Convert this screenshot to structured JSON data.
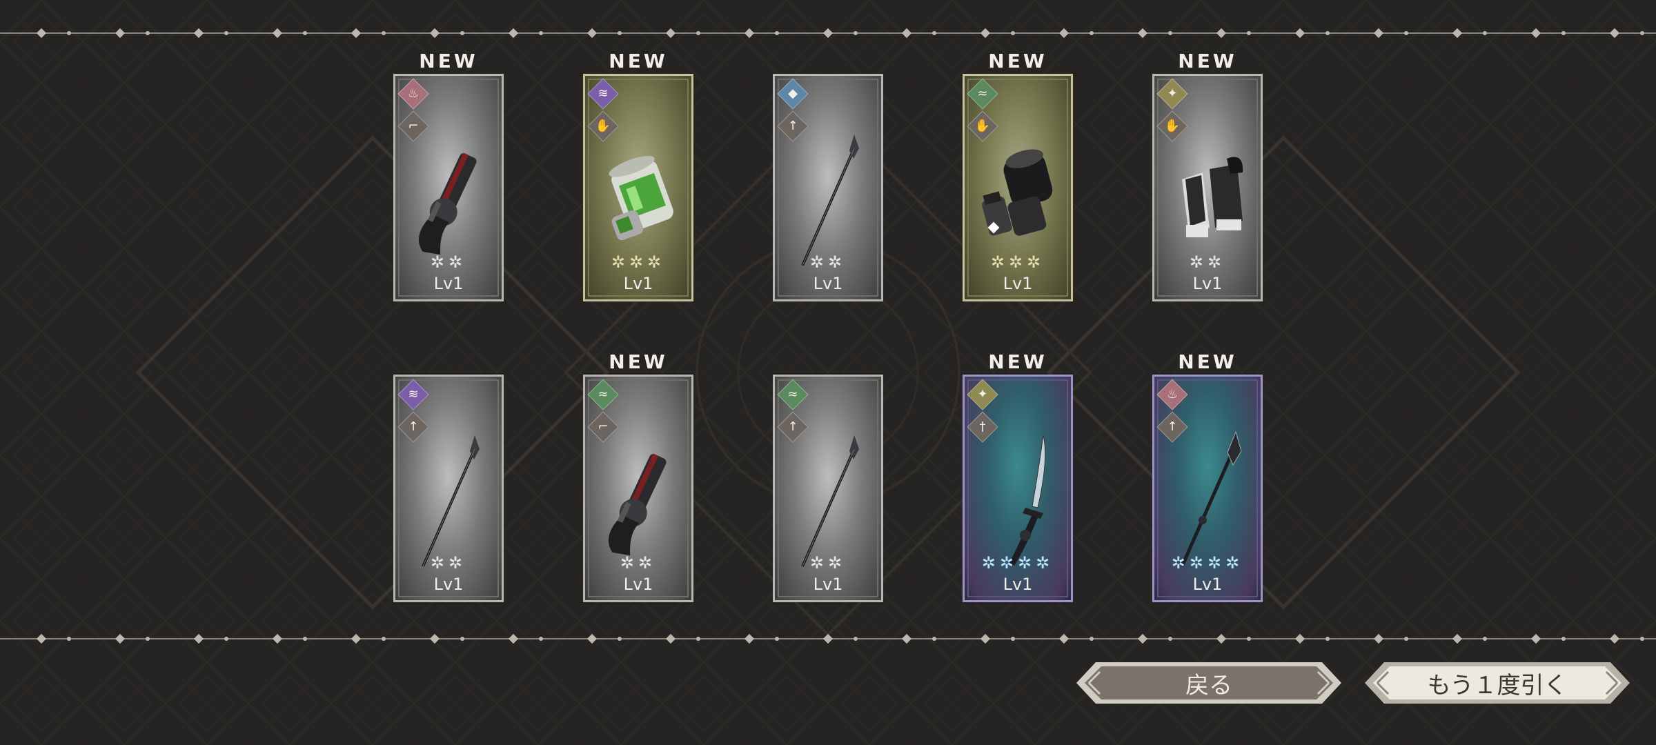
{
  "new_badge": "NEW",
  "items": [
    {
      "new": true,
      "rarity": 2,
      "frame": "gray",
      "attr_color": "#a8707a",
      "attr_icon": "flame-icon",
      "type_icon": "pistol-icon",
      "art": "revolver",
      "stars": "✲✲",
      "level": "Lv1"
    },
    {
      "new": true,
      "rarity": 3,
      "frame": "olive",
      "attr_color": "#7a5fa8",
      "attr_icon": "wave-icon",
      "type_icon": "gauntlet-icon",
      "art": "canister",
      "stars": "✲✲✲",
      "level": "Lv1"
    },
    {
      "new": false,
      "rarity": 2,
      "frame": "gray",
      "attr_color": "#5e86a8",
      "attr_icon": "ice-icon",
      "type_icon": "spear-icon",
      "art": "spear",
      "stars": "✲✲",
      "level": "Lv1"
    },
    {
      "new": true,
      "rarity": 3,
      "frame": "olive",
      "attr_color": "#5a8a5e",
      "attr_icon": "wind-icon",
      "type_icon": "gauntlet-icon",
      "art": "gauntlet",
      "stars": "✲✲✲",
      "level": "Lv1"
    },
    {
      "new": true,
      "rarity": 2,
      "frame": "gray",
      "attr_color": "#8e8a52",
      "attr_icon": "light-icon",
      "type_icon": "gauntlet-icon",
      "art": "gloves",
      "stars": "✲✲",
      "level": "Lv1"
    },
    {
      "new": false,
      "rarity": 2,
      "frame": "gray",
      "attr_color": "#7a5fa8",
      "attr_icon": "wave-icon",
      "type_icon": "spear-icon",
      "art": "spear",
      "stars": "✲✲",
      "level": "Lv1"
    },
    {
      "new": true,
      "rarity": 2,
      "frame": "gray",
      "attr_color": "#5a8a5e",
      "attr_icon": "wind-icon",
      "type_icon": "pistol-icon",
      "art": "revolver",
      "stars": "✲✲",
      "level": "Lv1"
    },
    {
      "new": false,
      "rarity": 2,
      "frame": "gray",
      "attr_color": "#5a8a5e",
      "attr_icon": "wind-icon",
      "type_icon": "spear-icon",
      "art": "spear",
      "stars": "✲✲",
      "level": "Lv1"
    },
    {
      "new": true,
      "rarity": 4,
      "frame": "teal",
      "attr_color": "#8e8a52",
      "attr_icon": "light-icon",
      "type_icon": "sword-icon",
      "art": "sword",
      "stars": "✲✲✲✲",
      "level": "Lv1"
    },
    {
      "new": true,
      "rarity": 4,
      "frame": "teal",
      "attr_color": "#a8707a",
      "attr_icon": "flame-icon",
      "type_icon": "spear-icon",
      "art": "spear-fancy",
      "stars": "✲✲✲✲",
      "level": "Lv1"
    }
  ],
  "buttons": {
    "back_label": "戻る",
    "draw_again_label": "もう１度引く"
  }
}
